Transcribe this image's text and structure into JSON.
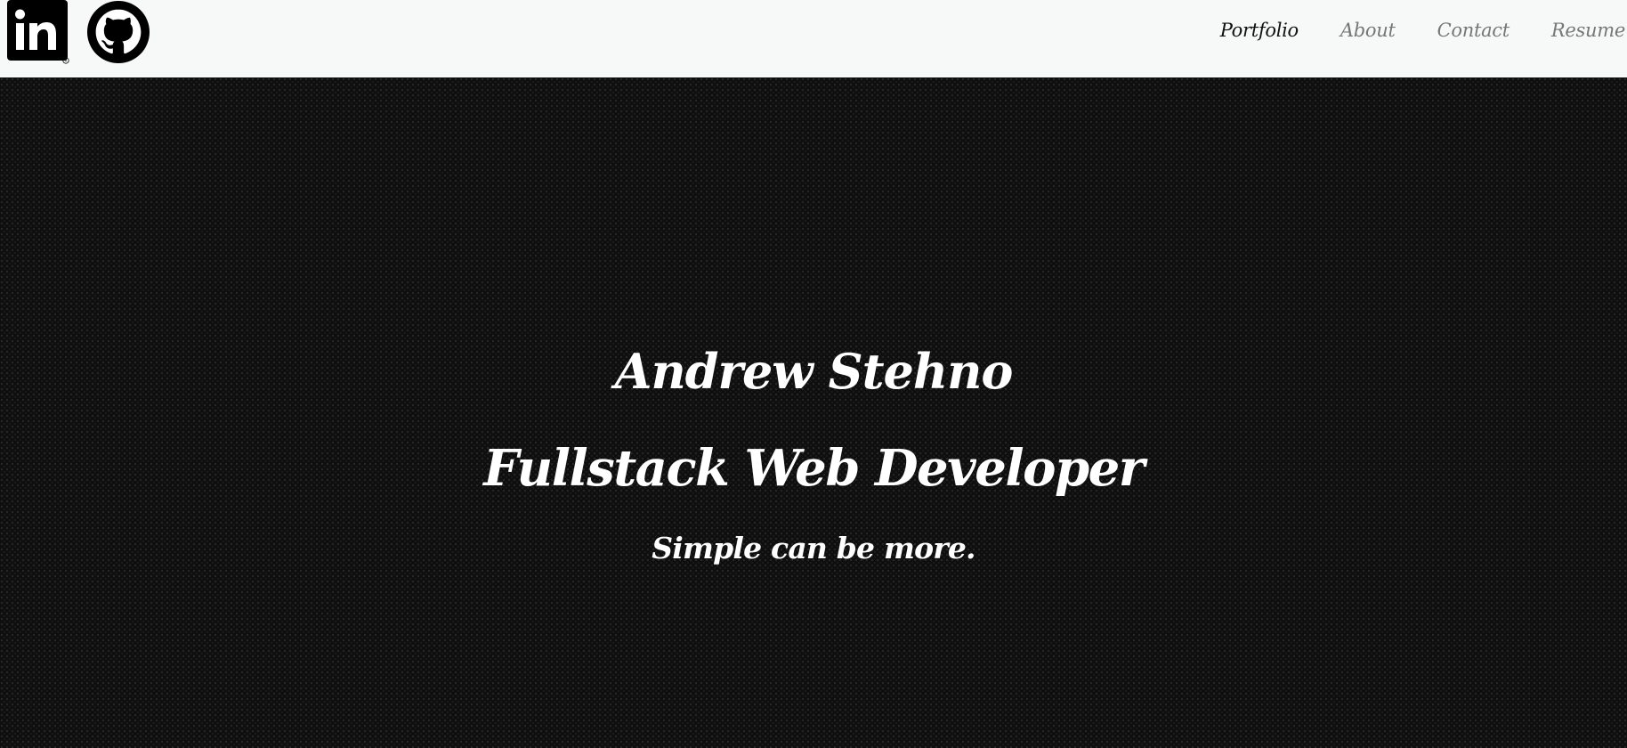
{
  "social": {
    "linkedin": {
      "icon": "linkedin-icon",
      "text": "in"
    },
    "github": {
      "icon": "github-icon"
    }
  },
  "nav": {
    "items": [
      {
        "label": "Portfolio",
        "active": true
      },
      {
        "label": "About",
        "active": false
      },
      {
        "label": "Contact",
        "active": false
      },
      {
        "label": "Resume",
        "active": false
      }
    ]
  },
  "hero": {
    "name": "Andrew Stehno",
    "title": "Fullstack Web Developer",
    "tagline": "Simple can be more."
  },
  "colors": {
    "navbar_bg": "#f7f8f8",
    "hero_bg": "#0e0e0e",
    "nav_active": "#111111",
    "nav_inactive": "#777777",
    "hero_text": "#ffffff"
  }
}
